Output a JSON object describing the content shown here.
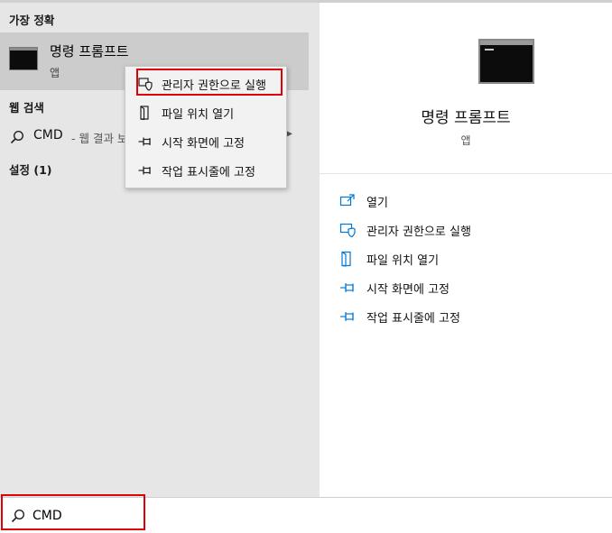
{
  "sections": {
    "best_match": "가장 정확",
    "web_search": "웹 검색",
    "settings": "설정 (1)"
  },
  "best_match_item": {
    "title": "명령 프롬프트",
    "subtitle": "앱"
  },
  "web_result": {
    "query": "CMD",
    "suffix": "- 웹 결과 보"
  },
  "context_menu": [
    {
      "label": "관리자 권한으로 실행",
      "icon": "shield-icon"
    },
    {
      "label": "파일 위치 열기",
      "icon": "file-location-icon"
    },
    {
      "label": "시작 화면에 고정",
      "icon": "pin-icon"
    },
    {
      "label": "작업 표시줄에 고정",
      "icon": "pin-icon"
    }
  ],
  "detail": {
    "app_name": "명령 프롬프트",
    "app_type": "앱",
    "actions": [
      {
        "label": "열기",
        "icon": "open-icon"
      },
      {
        "label": "관리자 권한으로 실행",
        "icon": "shield-icon"
      },
      {
        "label": "파일 위치 열기",
        "icon": "file-location-icon"
      },
      {
        "label": "시작 화면에 고정",
        "icon": "pin-icon"
      },
      {
        "label": "작업 표시줄에 고정",
        "icon": "pin-icon"
      }
    ]
  },
  "search": {
    "value": "CMD"
  },
  "colors": {
    "accent": "#0078d7",
    "highlight_box": "#e0000a"
  }
}
